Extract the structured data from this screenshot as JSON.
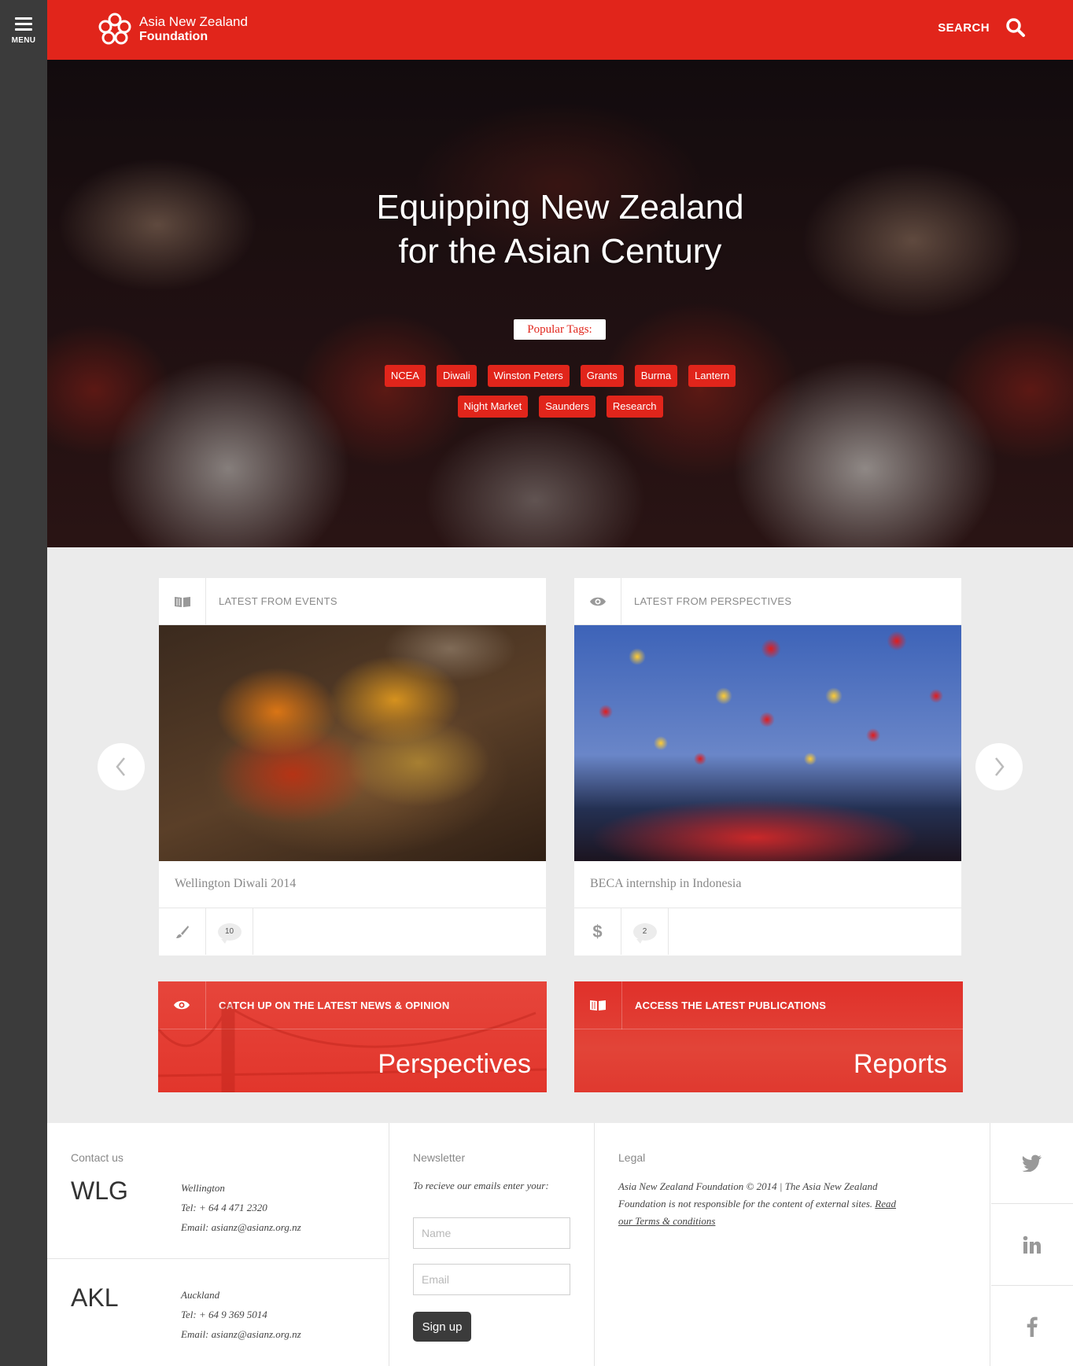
{
  "menu": {
    "label": "MENU"
  },
  "header": {
    "logo_line1": "Asia New Zealand",
    "logo_line2": "Foundation",
    "search_label": "SEARCH"
  },
  "hero": {
    "title_line1": "Equipping New Zealand",
    "title_line2": "for the Asian Century",
    "popular_label": "Popular Tags:",
    "tags_row1": [
      "NCEA",
      "Diwali",
      "Winston Peters",
      "Grants",
      "Burma",
      "Lantern"
    ],
    "tags_row2": [
      "Night Market",
      "Saunders",
      "Research"
    ]
  },
  "cards": [
    {
      "header": "LATEST FROM EVENTS",
      "icon": "book-icon",
      "title": "Wellington Diwali 2014",
      "foot_icon": "brush-icon",
      "comments": "10"
    },
    {
      "header": "LATEST FROM PERSPECTIVES",
      "icon": "eye-icon",
      "title": "BECA internship in Indonesia",
      "foot_icon": "dollar-icon",
      "comments": "2"
    }
  ],
  "promos": [
    {
      "header": "CATCH UP ON THE LATEST NEWS & OPINION",
      "icon": "eye-icon",
      "big": "Perspectives"
    },
    {
      "header": "ACCESS THE LATEST PUBLICATIONS",
      "icon": "book-icon",
      "big": "Reports"
    }
  ],
  "footer": {
    "contact_heading": "Contact us",
    "offices": [
      {
        "code": "WLG",
        "city": "Wellington",
        "tel": "Tel: + 64 4 471 2320",
        "email": "Email: asianz@asianz.org.nz"
      },
      {
        "code": "AKL",
        "city": "Auckland",
        "tel": "Tel: + 64 9 369 5014",
        "email": "Email: asianz@asianz.org.nz"
      }
    ],
    "newsletter_heading": "Newsletter",
    "newsletter_text": "To recieve our emails enter your:",
    "name_placeholder": "Name",
    "email_placeholder": "Email",
    "signup_label": "Sign up",
    "legal_heading": "Legal",
    "legal_text": "Asia New Zealand Foundation © 2014 | The Asia New Zealand Foundation is not responsible for the content of external sites.",
    "legal_link": "Read our Terms & conditions",
    "social": [
      "twitter-icon",
      "linkedin-icon",
      "facebook-icon"
    ]
  },
  "colors": {
    "brand_red": "#e1251b",
    "rail": "#3b3b3b",
    "page_bg": "#ebebeb"
  }
}
